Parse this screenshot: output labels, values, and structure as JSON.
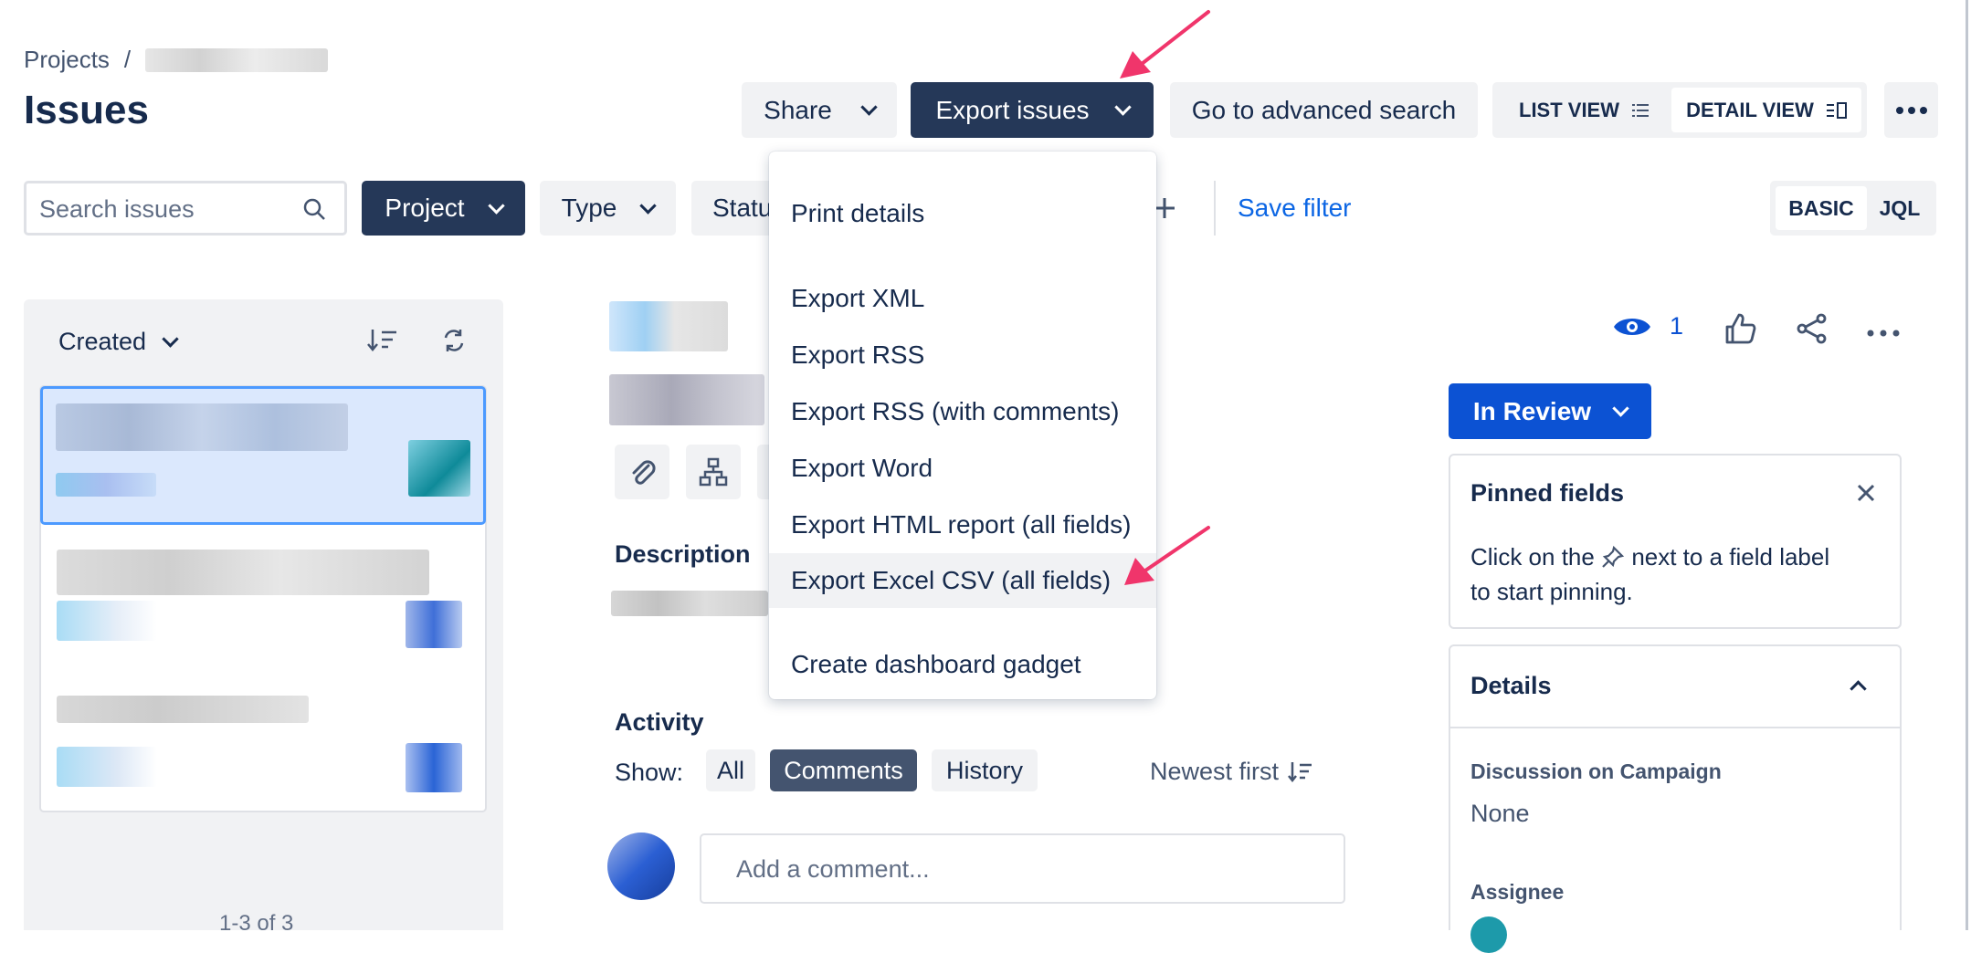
{
  "breadcrumb": {
    "projects": "Projects",
    "separator": "/"
  },
  "page_title": "Issues",
  "header_actions": {
    "share": "Share",
    "export_issues": "Export issues",
    "advanced_search": "Go to advanced search",
    "list_view": "LIST VIEW",
    "detail_view": "DETAIL VIEW"
  },
  "filters": {
    "search_placeholder": "Search issues",
    "project": "Project",
    "type": "Type",
    "status": "Statu",
    "save_filter": "Save filter",
    "basic": "BASIC",
    "jql": "JQL"
  },
  "export_menu": {
    "items": [
      "Print details",
      "Export XML",
      "Export RSS",
      "Export RSS (with comments)",
      "Export Word",
      "Export HTML report (all fields)",
      "Export Excel CSV (all fields)",
      "Create dashboard gadget"
    ],
    "highlighted_index": 6
  },
  "list_panel": {
    "sort_label": "Created",
    "pagination": "1-3 of 3"
  },
  "issue": {
    "description_heading": "Description",
    "activity_heading": "Activity",
    "show_label": "Show:",
    "show_tabs": [
      "All",
      "Comments",
      "History"
    ],
    "active_tab": "Comments",
    "newest_first": "Newest first",
    "comment_placeholder": "Add a comment...",
    "watch_count": "1",
    "status": "In Review"
  },
  "pinned_fields": {
    "title": "Pinned fields",
    "text_before": "Click on the",
    "text_after": "next to a field label to start pinning."
  },
  "details": {
    "title": "Details",
    "discussion_label": "Discussion on Campaign",
    "discussion_value": "None",
    "assignee_label": "Assignee"
  },
  "colors": {
    "dark_button": "#253858",
    "status_button": "#0c52d3",
    "link_blue": "#0c66e4",
    "annotation_arrow": "#f0356b",
    "menu_highlight": "#f1f2f4"
  }
}
